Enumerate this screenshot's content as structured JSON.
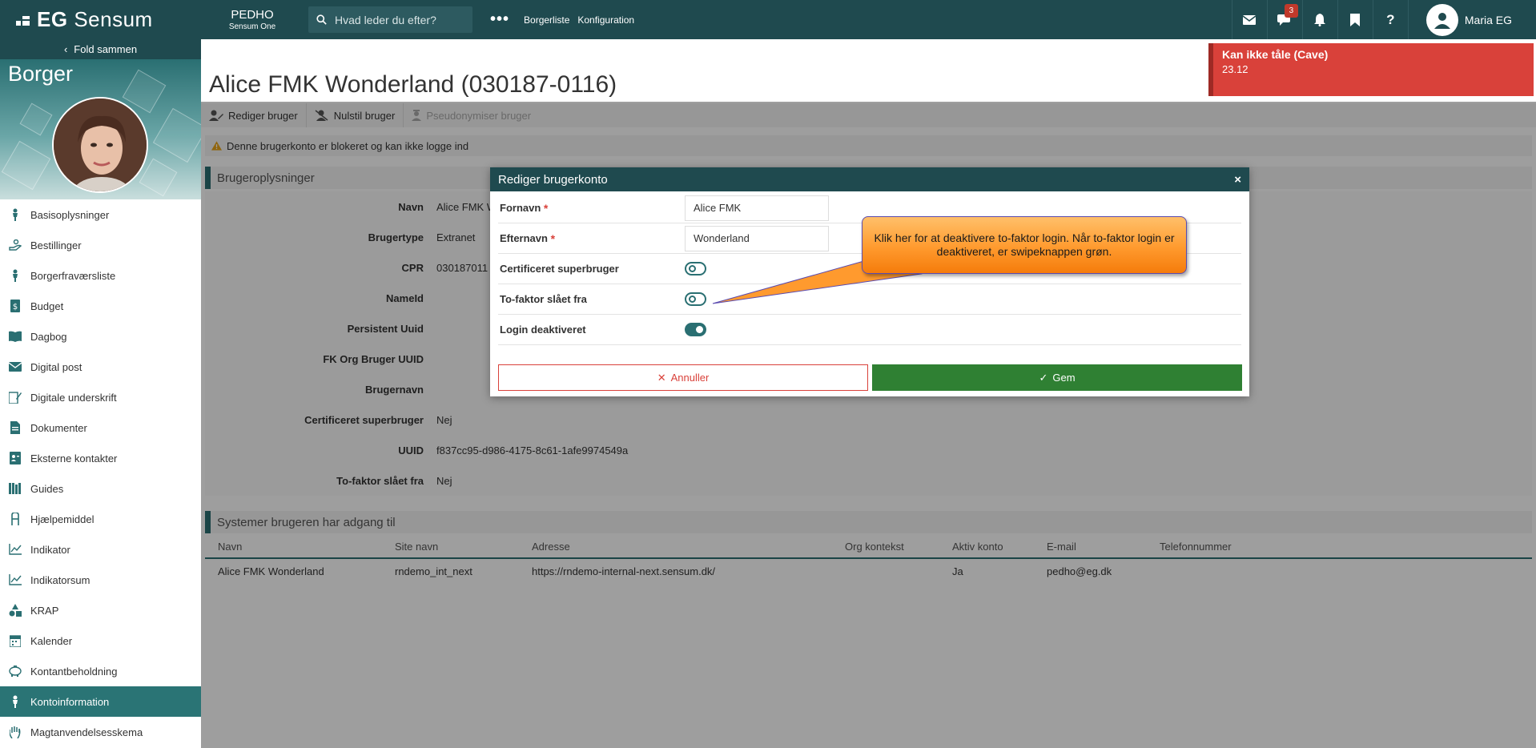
{
  "topbar": {
    "brand_bold": "EG",
    "brand_rest": "Sensum",
    "org_name": "PEDHO",
    "org_sub": "Sensum One",
    "search_placeholder": "Hvad leder du efter?",
    "nav": [
      "Borgerliste",
      "Konfiguration"
    ],
    "messages_badge": "3",
    "user_name": "Maria EG"
  },
  "sidebar": {
    "fold_label": "Fold sammen",
    "hero_title": "Borger",
    "items": [
      {
        "label": "Basisoplysninger",
        "icon": "person-icon"
      },
      {
        "label": "Bestillinger",
        "icon": "hand-icon"
      },
      {
        "label": "Borgerfraværsliste",
        "icon": "person-icon"
      },
      {
        "label": "Budget",
        "icon": "money-icon"
      },
      {
        "label": "Dagbog",
        "icon": "book-icon"
      },
      {
        "label": "Digital post",
        "icon": "envelope-icon"
      },
      {
        "label": "Digitale underskrift",
        "icon": "signature-icon"
      },
      {
        "label": "Dokumenter",
        "icon": "document-icon"
      },
      {
        "label": "Eksterne kontakter",
        "icon": "contact-card-icon"
      },
      {
        "label": "Guides",
        "icon": "books-icon"
      },
      {
        "label": "Hjælpemiddel",
        "icon": "walker-icon"
      },
      {
        "label": "Indikator",
        "icon": "line-chart-icon"
      },
      {
        "label": "Indikatorsum",
        "icon": "line-chart-icon"
      },
      {
        "label": "KRAP",
        "icon": "shapes-icon"
      },
      {
        "label": "Kalender",
        "icon": "calendar-icon"
      },
      {
        "label": "Kontantbeholdning",
        "icon": "piggy-bank-icon"
      },
      {
        "label": "Kontoinformation",
        "icon": "person-icon",
        "active": true
      },
      {
        "label": "Magtanvendelsesskema",
        "icon": "hand-stop-icon"
      }
    ]
  },
  "page": {
    "title": "Alice FMK Wonderland (030187-0116)",
    "cave_title": "Kan ikke tåle (Cave)",
    "cave_value": "23.12",
    "toolbar": [
      "Rediger bruger",
      "Nulstil bruger",
      "Pseudonymiser bruger"
    ],
    "warning": "Denne brugerkonto er blokeret og kan ikke logge ind",
    "user_section_title": "Brugeroplysninger",
    "fields": [
      {
        "label": "Navn",
        "value": "Alice FMK W"
      },
      {
        "label": "Brugertype",
        "value": "Extranet"
      },
      {
        "label": "CPR",
        "value": "030187011"
      },
      {
        "label": "NameId",
        "value": ""
      },
      {
        "label": "Persistent Uuid",
        "value": ""
      },
      {
        "label": "FK Org Bruger UUID",
        "value": ""
      },
      {
        "label": "Brugernavn",
        "value": ""
      },
      {
        "label": "Certificeret superbruger",
        "value": "Nej"
      },
      {
        "label": "UUID",
        "value": "f837cc95-d986-4175-8c61-1afe9974549a"
      },
      {
        "label": "To-faktor slået fra",
        "value": "Nej"
      }
    ],
    "systems_title": "Systemer brugeren har adgang til",
    "systems_columns": [
      "Navn",
      "Site navn",
      "Adresse",
      "Org kontekst",
      "Aktiv konto",
      "E-mail",
      "Telefonnummer"
    ],
    "systems_rows": [
      [
        "Alice FMK Wonderland",
        "rndemo_int_next",
        "https://rndemo-internal-next.sensum.dk/",
        "",
        "Ja",
        "pedho@eg.dk",
        ""
      ]
    ]
  },
  "modal": {
    "title": "Rediger brugerkonto",
    "fornavn_label": "Fornavn",
    "fornavn_value": "Alice FMK",
    "efternavn_label": "Efternavn",
    "efternavn_value": "Wonderland",
    "required_mark": "*",
    "cert_label": "Certificeret superbruger",
    "cert_on": false,
    "twofactor_label": "To-faktor slået fra",
    "twofactor_on": false,
    "login_label": "Login deaktiveret",
    "login_on": true,
    "cancel_label": "Annuller",
    "save_label": "Gem"
  },
  "callout": {
    "text": "Klik her for at deaktivere to-faktor login. Når to-faktor login er deaktiveret, er swipeknappen grøn."
  },
  "colors": {
    "header": "#1f4a4f",
    "accent": "#2a6f72",
    "cave": "#d9413a",
    "save": "#2f8033",
    "callout": "#ff9a2e"
  }
}
